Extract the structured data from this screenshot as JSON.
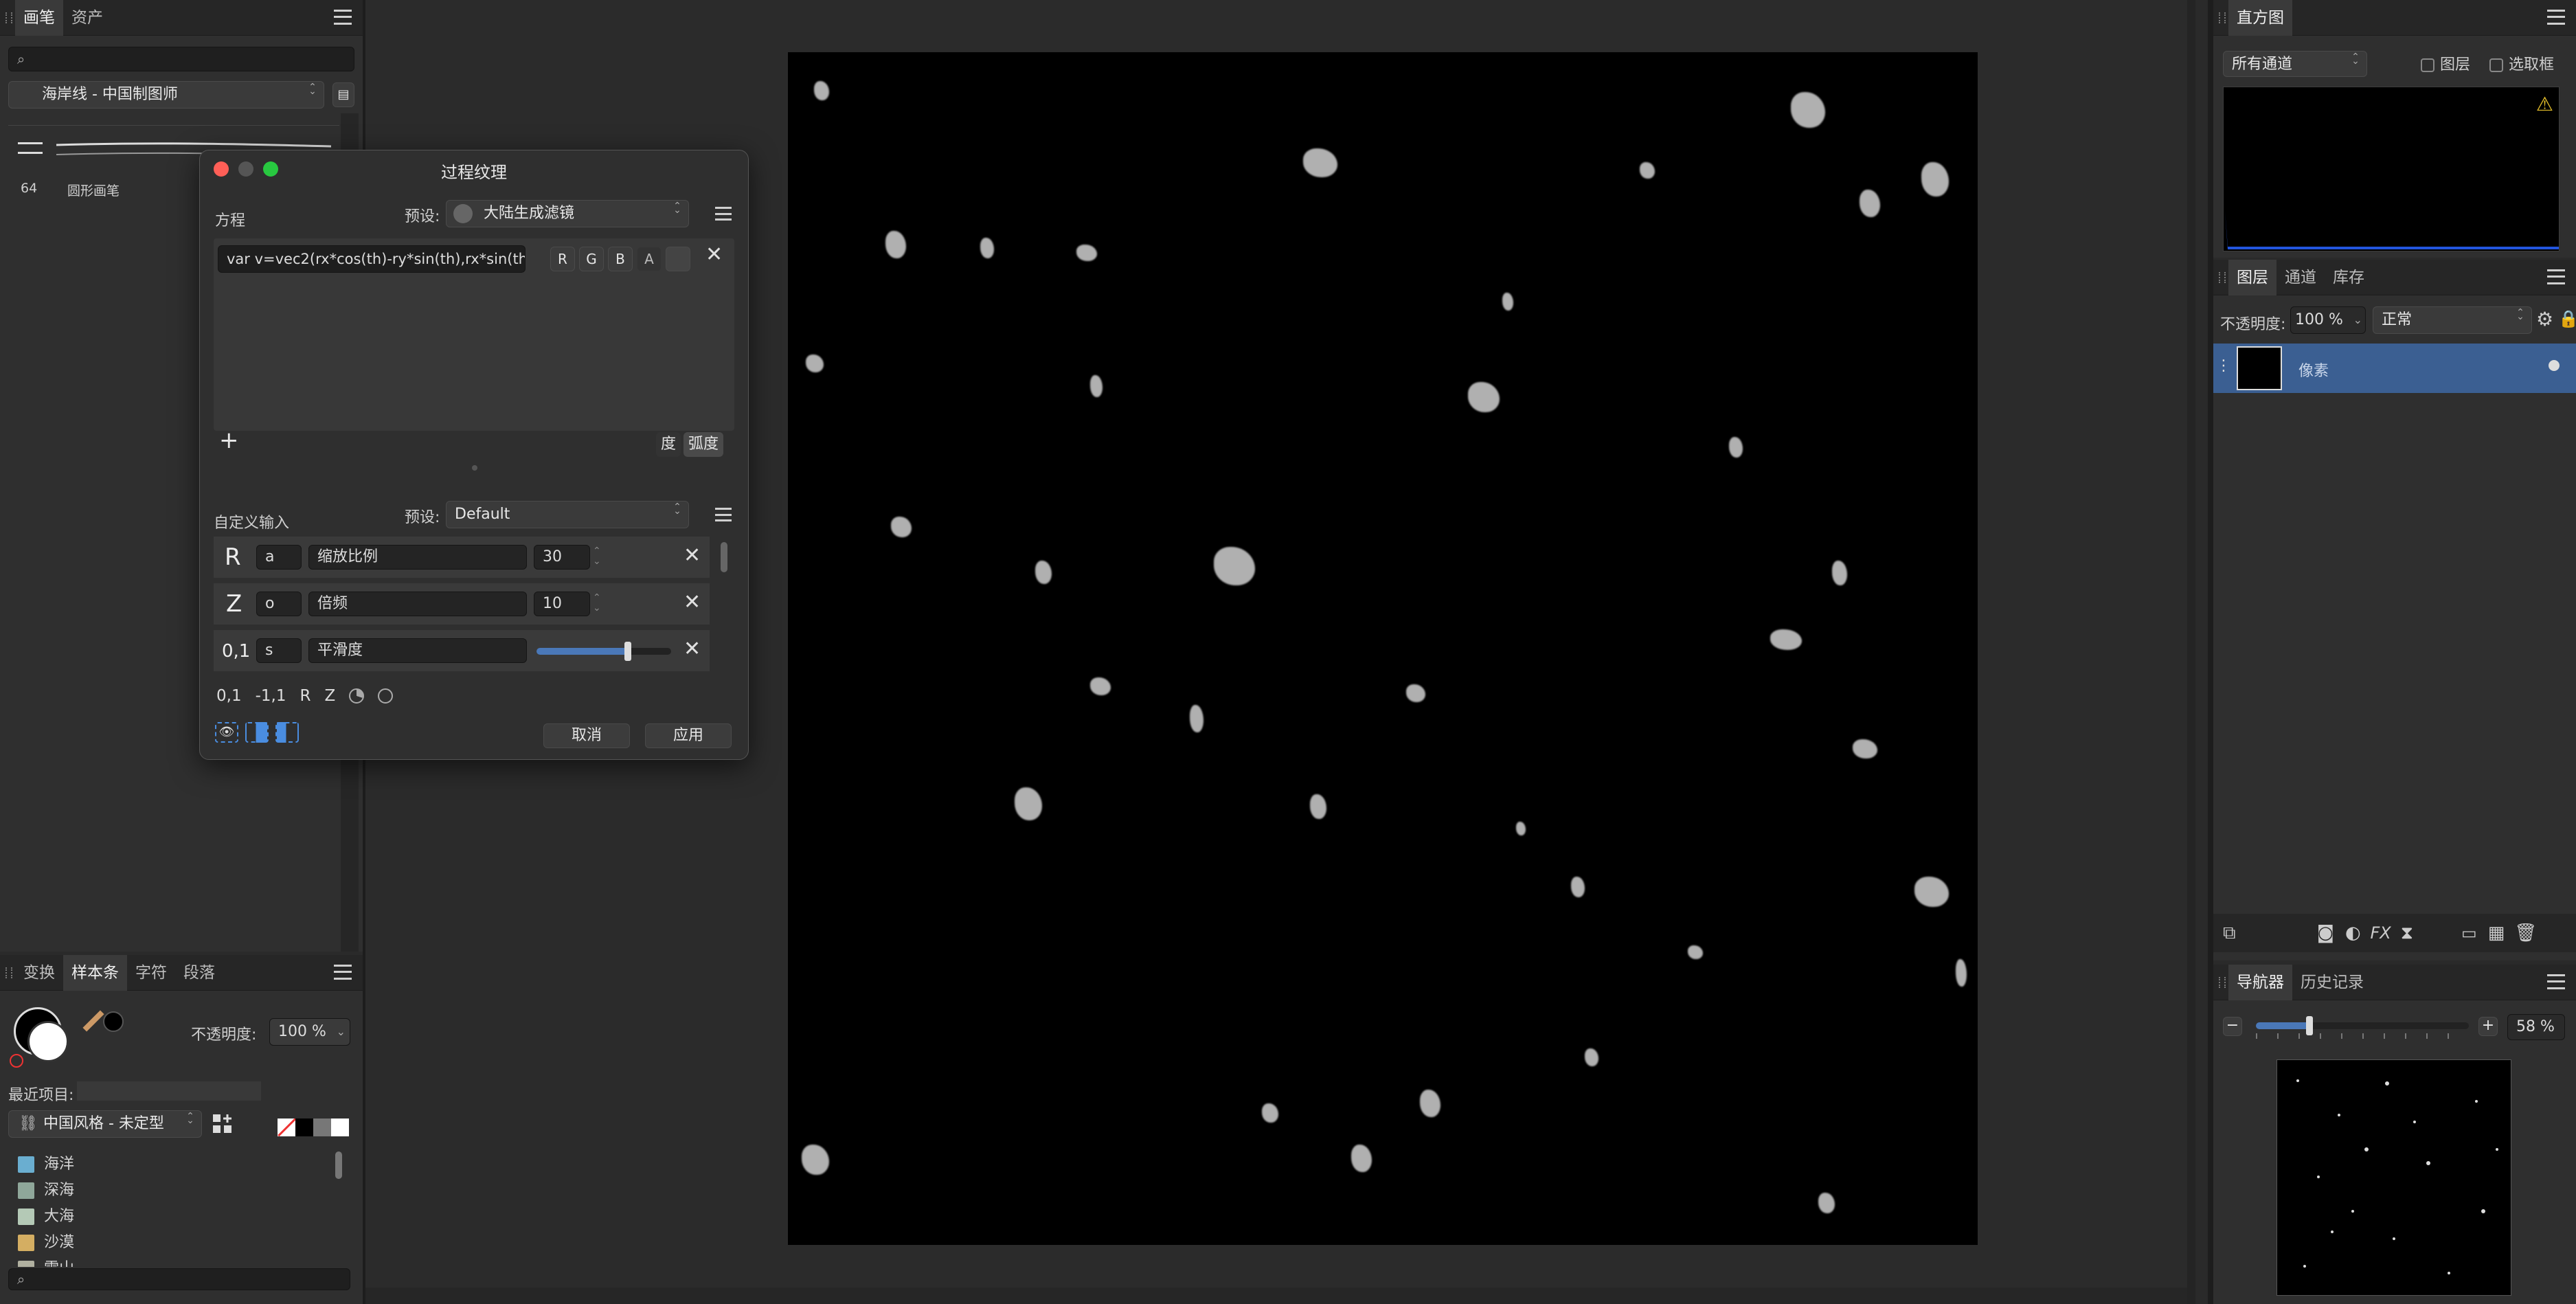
{
  "left_top": {
    "tabs": [
      "画笔",
      "资产"
    ],
    "category": "海岸线 - 中国制图师",
    "brush_size": "64",
    "brush_name": "圆形画笔"
  },
  "left_bottom": {
    "tabs": [
      "变换",
      "样本条",
      "字符",
      "段落"
    ],
    "opacity_label": "不透明度:",
    "opacity_value": "100 %",
    "recent_label": "最近项目:",
    "palette": "中国风格 - 未定型",
    "colors": [
      {
        "name": "海洋",
        "color": "#6aaed0"
      },
      {
        "name": "深海",
        "color": "#8fa79a"
      },
      {
        "name": "大海",
        "color": "#b4c9b6"
      },
      {
        "name": "沙漠",
        "color": "#d4ae62"
      },
      {
        "name": "雪山",
        "color": "#b0b0a0"
      }
    ]
  },
  "dialog": {
    "title": "过程纹理",
    "equation_label": "方程",
    "preset_label": "预设:",
    "equation_preset": "大陆生成滤镜",
    "equation_value": "var v=vec2(rx*cos(th)-ry*sin(th),rx*sin(th",
    "channels": [
      "R",
      "G",
      "B",
      "A"
    ],
    "add_label": "+",
    "deg_label": "度",
    "rad_label": "弧度",
    "custom_label": "自定义输入",
    "custom_preset": "Default",
    "inputs": [
      {
        "type": "R",
        "var": "a",
        "name": "缩放比例",
        "value": "30"
      },
      {
        "type": "Z",
        "var": "o",
        "name": "倍频",
        "value": "10"
      },
      {
        "type": "0,1",
        "var": "s",
        "name": "平滑度",
        "value": 0.68
      }
    ],
    "add_types": [
      "0,1",
      "-1,1",
      "R",
      "Z"
    ],
    "cancel": "取消",
    "apply": "应用"
  },
  "histogram": {
    "tab": "直方图",
    "channel": "所有通道",
    "layer_label": "图层",
    "selection_label": "选取框"
  },
  "layers": {
    "tabs": [
      "图层",
      "通道",
      "库存"
    ],
    "opacity_label": "不透明度:",
    "opacity_value": "100 %",
    "blend": "正常",
    "layer_name": "像素"
  },
  "navigator": {
    "tabs": [
      "导航器",
      "历史记录"
    ],
    "zoom": "58 %",
    "zoom_fraction": 0.25
  }
}
